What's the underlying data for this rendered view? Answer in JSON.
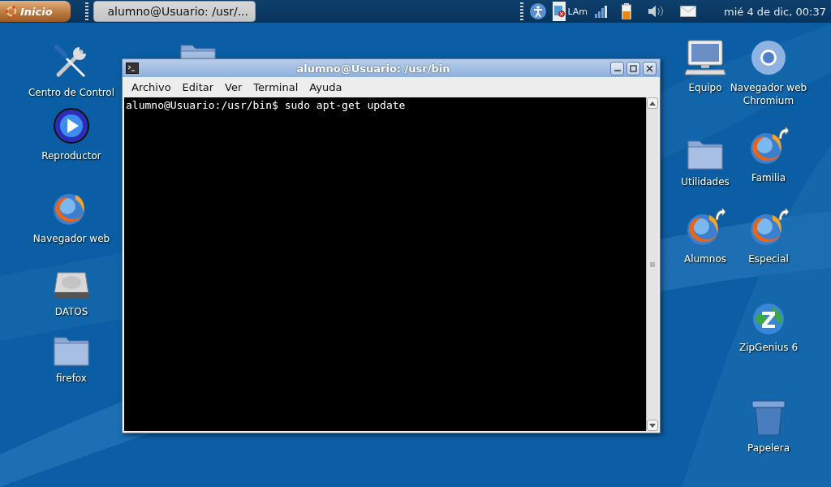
{
  "panel": {
    "start_button": "Inicio",
    "tasks": [
      {
        "label": "alumno@Usuario: /usr/...",
        "selected": true
      }
    ],
    "tray": {
      "network_label": "LAm",
      "clock": "mié  4 de dic, 00:37"
    }
  },
  "desktop_left": [
    {
      "label": "Centro de Control",
      "kind": "tools"
    },
    {
      "label": "Reproductor",
      "kind": "player"
    },
    {
      "label": "Navegador web",
      "kind": "firefox"
    },
    {
      "label": "DATOS",
      "kind": "drive"
    },
    {
      "label": "firefox",
      "kind": "folder"
    }
  ],
  "desktop_right": [
    {
      "label": "Equipo",
      "kind": "computer"
    },
    {
      "label": "Navegador web Chromium",
      "kind": "chromium"
    },
    {
      "label": "Utilidades",
      "kind": "folder"
    },
    {
      "label": "Familia",
      "kind": "firefox-link"
    },
    {
      "label": "Alumnos",
      "kind": "firefox-link"
    },
    {
      "label": "Especial",
      "kind": "firefox-link"
    },
    {
      "label": "ZipGenius 6",
      "kind": "zip"
    },
    {
      "label": "Papelera",
      "kind": "trash"
    }
  ],
  "window": {
    "title": "alumno@Usuario: /usr/bin",
    "menu": [
      "Archivo",
      "Editar",
      "Ver",
      "Terminal",
      "Ayuda"
    ],
    "terminal_lines": [
      "alumno@Usuario:/usr/bin$ sudo apt-get update"
    ]
  }
}
